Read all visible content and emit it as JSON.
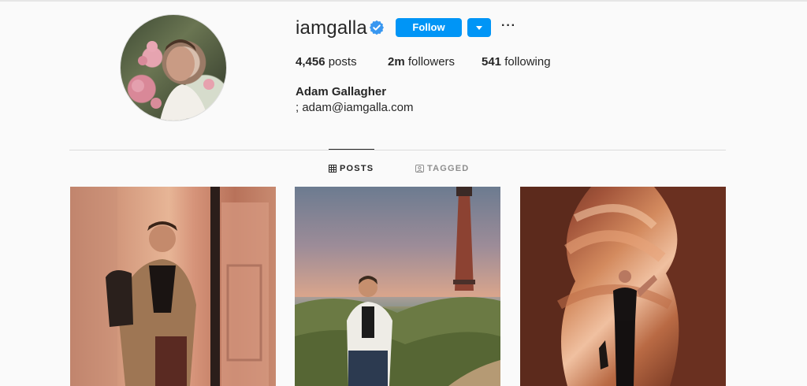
{
  "profile": {
    "username": "iamgalla",
    "verified": true,
    "follow_label": "Follow",
    "more_label": "···",
    "stats": {
      "posts_count": "4,456",
      "posts_label": "posts",
      "followers_count": "2m",
      "followers_label": "followers",
      "following_count": "541",
      "following_label": "following"
    },
    "full_name": "Adam Gallagher",
    "bio": "; adam@iamgalla.com"
  },
  "tabs": [
    {
      "label": "POSTS",
      "icon": "grid-icon",
      "active": true
    },
    {
      "label": "TAGGED",
      "icon": "tag-icon",
      "active": false
    }
  ],
  "colors": {
    "accent": "#0095f6",
    "text": "#262626",
    "muted": "#8e8e8e",
    "background": "#fafafa"
  }
}
